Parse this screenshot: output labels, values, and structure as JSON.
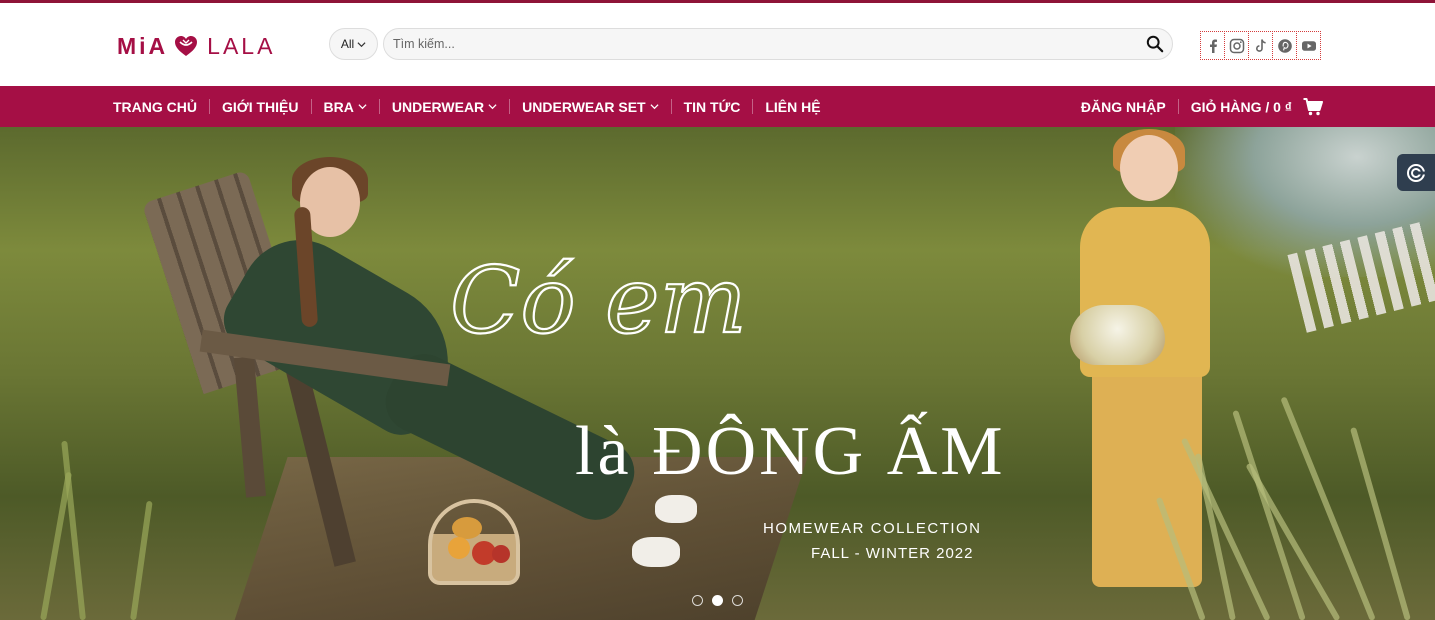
{
  "brand": {
    "name_left": "MiA",
    "name_right": "LALA",
    "color": "#a50f45",
    "accent_dark": "#8e1438"
  },
  "search": {
    "category": "All",
    "placeholder": "Tìm kiếm..."
  },
  "socials": [
    "facebook-icon",
    "instagram-icon",
    "tiktok-icon",
    "pinterest-icon",
    "youtube-icon"
  ],
  "nav": {
    "items": [
      {
        "label": "TRANG CHỦ",
        "has_dropdown": false
      },
      {
        "label": "GIỚI THIỆU",
        "has_dropdown": false
      },
      {
        "label": "BRA",
        "has_dropdown": true
      },
      {
        "label": "UNDERWEAR",
        "has_dropdown": true
      },
      {
        "label": "UNDERWEAR SET",
        "has_dropdown": true
      },
      {
        "label": "TIN TỨC",
        "has_dropdown": false
      },
      {
        "label": "LIÊN HỆ",
        "has_dropdown": false
      }
    ],
    "login": "ĐĂNG NHẬP",
    "cart": "GIỎ HÀNG / 0 ₫"
  },
  "hero": {
    "script_line": "Có em",
    "headline": "là ĐÔNG ẤM",
    "subtitle_1": "HOMEWEAR  COLLECTION",
    "subtitle_2": "FALL - WINTER 2022",
    "slides": 3,
    "active_slide": 2
  }
}
